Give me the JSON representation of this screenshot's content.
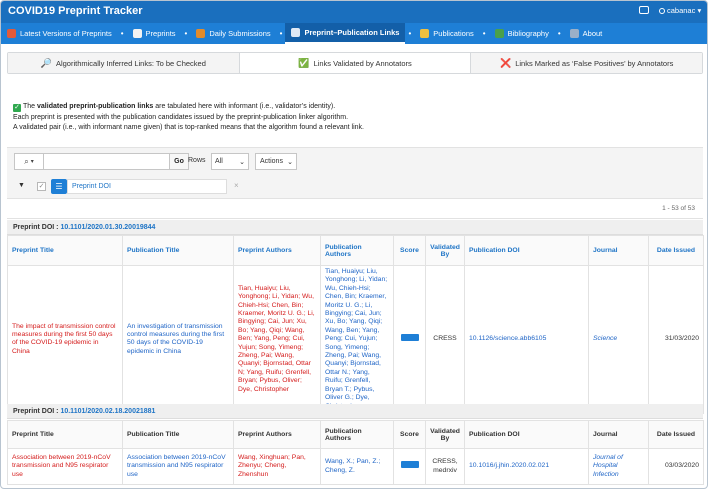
{
  "app": {
    "title": "COVID19 Preprint Tracker",
    "user": "cabanac",
    "user_caret": "▾"
  },
  "nav": {
    "items": [
      {
        "label": "Latest Versions of Preprints",
        "icon": "home-icon",
        "color": "#e25a3a"
      },
      {
        "label": "Preprints",
        "icon": "document-icon",
        "color": "#f2f2f2"
      },
      {
        "label": "Daily Submissions",
        "icon": "calendar-icon",
        "color": "#e28b2b"
      },
      {
        "label": "Preprint–Publication Links",
        "icon": "link-icon",
        "color": "#dfe9f5",
        "active": true
      },
      {
        "label": "Publications",
        "icon": "article-icon",
        "color": "#f0c040"
      },
      {
        "label": "Bibliography",
        "icon": "books-icon",
        "color": "#4aa04a"
      },
      {
        "label": "About",
        "icon": "info-icon",
        "color": "#9bb0c8"
      }
    ],
    "separator": "•"
  },
  "tabs": [
    {
      "label": "Algorithmically Inferred Links: To be Checked",
      "icon": "magnifier-icon",
      "glyph": "🔎"
    },
    {
      "label": "Links Validated by Annotators",
      "icon": "check-icon",
      "glyph": "✅"
    },
    {
      "label": "Links Marked as ‘False Positives’ by Annotators",
      "icon": "cross-icon",
      "glyph": "❌"
    }
  ],
  "info": {
    "line1_pre": "The ",
    "line1_bold": "validated preprint-publication links",
    "line1_post": " are tabulated here with informant (i.e., validator’s identity).",
    "line2": "Each preprint is presented with the publication candidates issued by the preprint-publication linker algorithm.",
    "line3": "A validated pair (i.e., with informant name given) that is top-ranked means that the algorithm found a relevant link."
  },
  "toolbar": {
    "search_value": "",
    "go_label": "Go",
    "rows_label": "Rows",
    "rows_value": "All",
    "actions_label": "Actions"
  },
  "filter": {
    "toggle": "▼",
    "label": "Preprint DOI",
    "remove": "×"
  },
  "pager": {
    "text": "1 - 53 of 53"
  },
  "columns": [
    "Preprint Title",
    "Publication Title",
    "Preprint Authors",
    "Publication Authors",
    "Score",
    "Validated By",
    "Publication DOI",
    "Journal",
    "Date Issued"
  ],
  "groups": [
    {
      "label": "Preprint DOI : ",
      "doi": "10.1101/2020.01.30.20019844",
      "rows": [
        {
          "preprint_title": "The impact of transmission control measures during the first 50 days of the COVID-19 epidemic in China",
          "publication_title": "An investigation of transmission control measures during the first 50 days of the COVID-19 epidemic in China",
          "preprint_authors": "Tian, Huaiyu; Liu, Yonghong; Li, Yidan; Wu, Chieh-Hsi; Chen, Bin; Kraemer, Moritz U. G.; Li, Bingying; Cai, Jun; Xu, Bo; Yang, Qiqi; Wang, Ben; Yang, Peng; Cui, Yujun; Song, Yimeng; Zheng, Pai; Wang, Quanyi; Bjornstad, Ottar N; Yang, Ruifu; Grenfell, Bryan; Pybus, Oliver; Dye, Christopher",
          "publication_authors": "Tian, Huaiyu; Liu, Yonghong; Li, Yidan; Wu, Chieh-Hsi; Chen, Bin; Kraemer, Moritz U. G.; Li, Bingying; Cai, Jun; Xu, Bo; Yang, Qiqi; Wang, Ben; Yang, Peng; Cui, Yujun; Song, Yimeng; Zheng, Pai; Wang, Quanyi; Bjornstad, Ottar N.; Yang, Ruifu; Grenfell, Bryan T.; Pybus, Oliver G.; Dye, Christopher",
          "validated_by": "CRESS",
          "publication_doi": "10.1126/science.abb6105",
          "journal": "Science",
          "date_issued": "31/03/2020"
        }
      ]
    },
    {
      "label": "Preprint DOI : ",
      "doi": "10.1101/2020.02.18.20021881",
      "rows": [
        {
          "preprint_title": "Association between 2019-nCoV transmission and N95 respirator use",
          "publication_title": "Association between 2019-nCoV transmission and N95 respirator use",
          "preprint_authors": "Wang, Xinghuan; Pan, Zhenyu; Cheng, Zhenshun",
          "publication_authors": "Wang, X.; Pan, Z.; Cheng, Z.",
          "validated_by": "CRESS, medrxiv",
          "publication_doi": "10.1016/j.jhin.2020.02.021",
          "journal": "Journal of Hospital Infection",
          "date_issued": "03/03/2020"
        }
      ]
    }
  ],
  "colors": {
    "header": "#1a6fbe",
    "nav": "#1e7fd6",
    "link": "#1e74c6",
    "preprint_title": "#d41b1b",
    "score": "#1e7fd6"
  }
}
